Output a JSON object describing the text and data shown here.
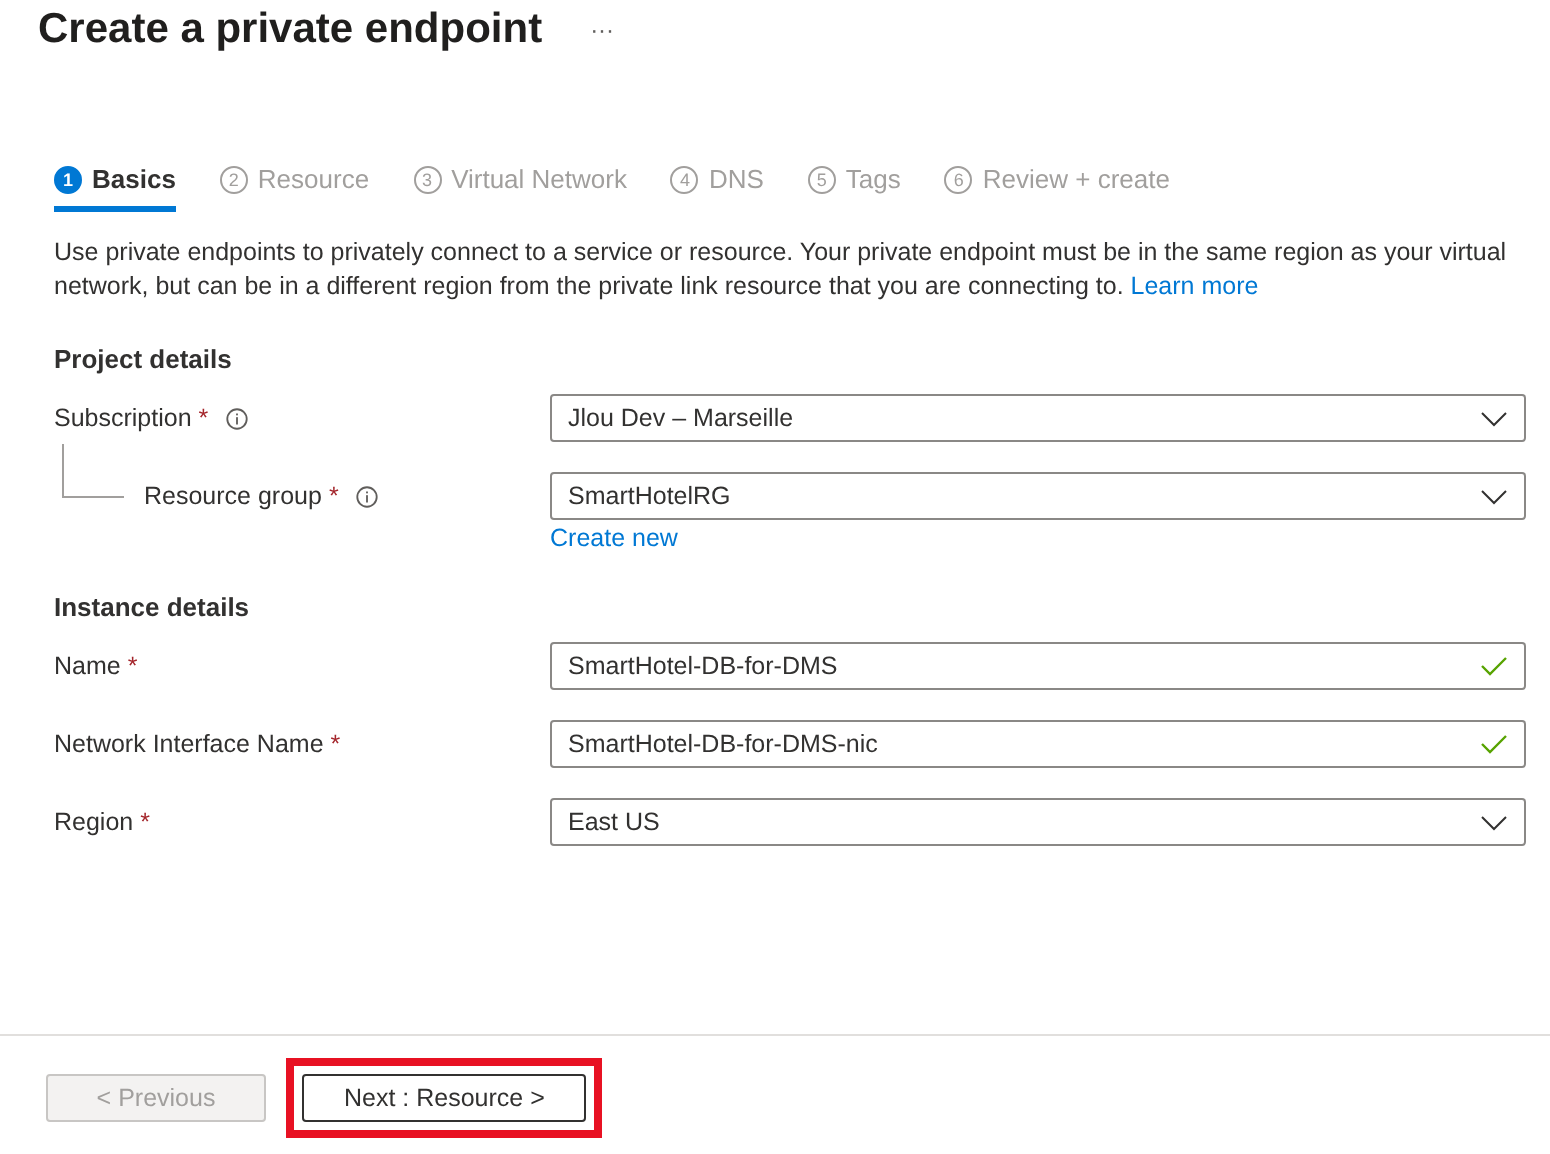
{
  "title": "Create a private endpoint",
  "more": "···",
  "tabs": [
    {
      "number": "1",
      "label": "Basics",
      "selected": true
    },
    {
      "number": "2",
      "label": "Resource",
      "selected": false
    },
    {
      "number": "3",
      "label": "Virtual Network",
      "selected": false
    },
    {
      "number": "4",
      "label": "DNS",
      "selected": false
    },
    {
      "number": "5",
      "label": "Tags",
      "selected": false
    },
    {
      "number": "6",
      "label": "Review + create",
      "selected": false
    }
  ],
  "description": "Use private endpoints to privately connect to a service or resource. Your private endpoint must be in the same region as your virtual network, but can be in a different region from the private link resource that you are connecting to.",
  "learn_more": "Learn more",
  "sections": [
    {
      "heading": "Project details",
      "fields": [
        {
          "label": "Subscription",
          "required_mark": "*",
          "info": true,
          "nested": false,
          "kind": "select",
          "value": "Jlou Dev – Marseille",
          "valid": false
        },
        {
          "label": "Resource group",
          "required_mark": "*",
          "info": true,
          "nested": true,
          "kind": "select",
          "value": "SmartHotelRG",
          "valid": false,
          "link": "Create new"
        }
      ]
    },
    {
      "heading": "Instance details",
      "fields": [
        {
          "label": "Name",
          "required_mark": "*",
          "info": false,
          "nested": false,
          "kind": "text",
          "value": "SmartHotel-DB-for-DMS",
          "valid": true
        },
        {
          "label": "Network Interface Name",
          "required_mark": "*",
          "info": false,
          "nested": false,
          "kind": "text",
          "value": "SmartHotel-DB-for-DMS-nic",
          "valid": true
        },
        {
          "label": "Region",
          "required_mark": "*",
          "info": false,
          "nested": false,
          "kind": "select",
          "value": "East US",
          "valid": false
        }
      ]
    }
  ],
  "buttons": [
    {
      "label": "< Previous",
      "disabled": true,
      "highlighted": false
    },
    {
      "label": "Next : Resource >",
      "disabled": false,
      "highlighted": true
    }
  ]
}
